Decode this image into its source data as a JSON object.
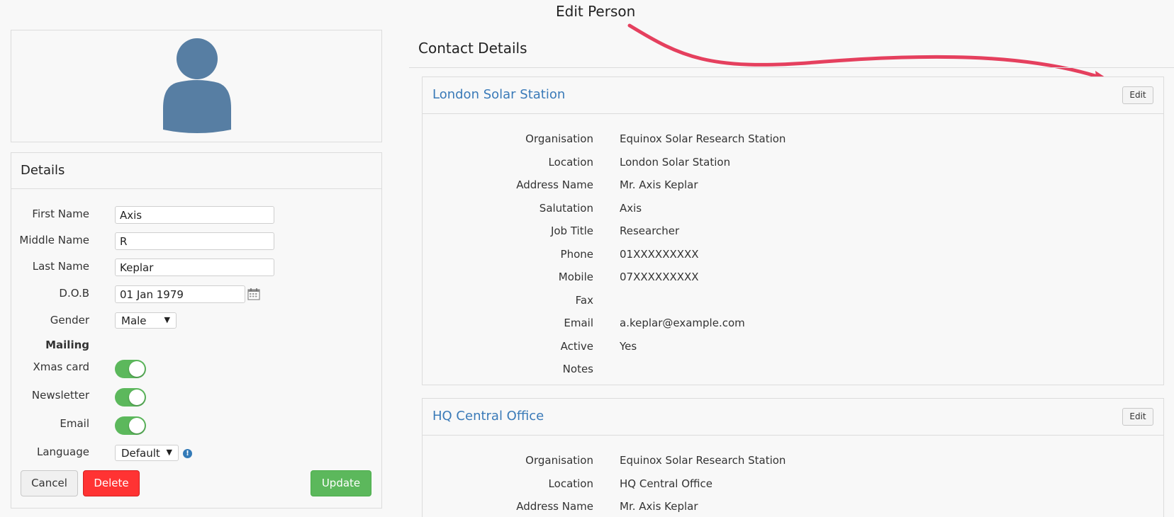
{
  "annotation": {
    "label": "Edit Person",
    "arrow_color": "#e5405e"
  },
  "colors": {
    "accent": "#3a7ab8",
    "toggle_on": "#5cb85c",
    "danger": "#ff3333",
    "success": "#5cb85c",
    "avatar": "#577ea3"
  },
  "details": {
    "heading": "Details",
    "first_name": {
      "label": "First Name",
      "value": "Axis"
    },
    "middle_name": {
      "label": "Middle Name",
      "value": "R"
    },
    "last_name": {
      "label": "Last Name",
      "value": "Keplar"
    },
    "dob": {
      "label": "D.O.B",
      "value": "01 Jan 1979"
    },
    "gender": {
      "label": "Gender",
      "value": "Male"
    },
    "mailing_heading": "Mailing",
    "xmas_card": {
      "label": "Xmas card",
      "on": true
    },
    "newsletter": {
      "label": "Newsletter",
      "on": true
    },
    "email_toggle": {
      "label": "Email",
      "on": true
    },
    "language": {
      "label": "Language",
      "value": "Default"
    },
    "buttons": {
      "cancel": "Cancel",
      "delete": "Delete",
      "update": "Update"
    }
  },
  "contact": {
    "title": "Contact Details",
    "edit_label": "Edit",
    "cards": [
      {
        "title": "London Solar Station",
        "rows": [
          {
            "k": "Organisation",
            "v": "Equinox Solar Research Station"
          },
          {
            "k": "Location",
            "v": "London Solar Station"
          },
          {
            "k": "Address Name",
            "v": "Mr. Axis Keplar"
          },
          {
            "k": "Salutation",
            "v": "Axis"
          },
          {
            "k": "Job Title",
            "v": "Researcher"
          },
          {
            "k": "Phone",
            "v": "01XXXXXXXXX"
          },
          {
            "k": "Mobile",
            "v": "07XXXXXXXXX"
          },
          {
            "k": "Fax",
            "v": ""
          },
          {
            "k": "Email",
            "v": "a.keplar@example.com"
          },
          {
            "k": "Active",
            "v": "Yes"
          },
          {
            "k": "Notes",
            "v": ""
          }
        ]
      },
      {
        "title": "HQ Central Office",
        "rows": [
          {
            "k": "Organisation",
            "v": "Equinox Solar Research Station"
          },
          {
            "k": "Location",
            "v": "HQ Central Office"
          },
          {
            "k": "Address Name",
            "v": "Mr. Axis Keplar"
          }
        ]
      }
    ]
  }
}
